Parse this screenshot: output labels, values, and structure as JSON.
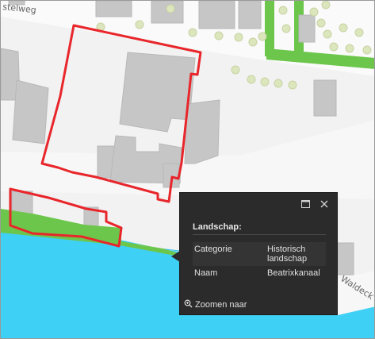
{
  "map": {
    "street_labels": {
      "top_left": "stelweg",
      "bottom_right": "Waldeck Pyrmon"
    },
    "colors": {
      "water": "#3fd0f5",
      "water_edge": "#2bc0e8",
      "green": "#6dc64c",
      "highlight": "#e8262b",
      "building": "#c6c6c6",
      "tree": "#dce6bc"
    }
  },
  "popup": {
    "title": "Landschap:",
    "maximize_icon": "maximize-icon",
    "close_icon": "close-icon",
    "attributes": [
      {
        "key": "Categorie",
        "value": "Historisch landschap"
      },
      {
        "key": "Naam",
        "value": "Beatrixkanaal"
      }
    ],
    "zoom_label": "Zoomen naar",
    "zoom_icon": "magnifier-icon"
  }
}
